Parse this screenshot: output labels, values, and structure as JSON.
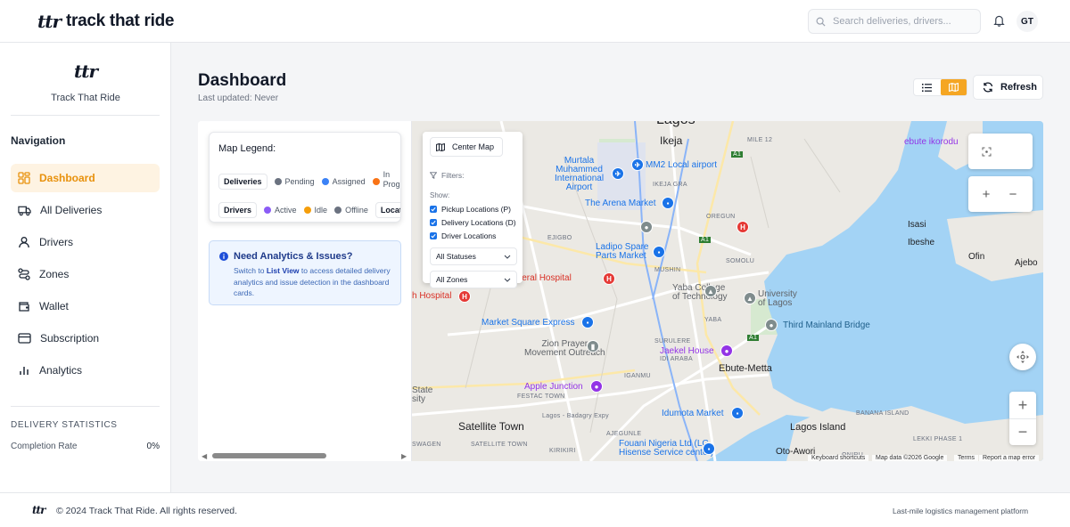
{
  "app": {
    "brand_mark": "ttr",
    "brand_name": "track that ride"
  },
  "header": {
    "search_placeholder": "Search deliveries, drivers...",
    "avatar_initials": "GT"
  },
  "sidebar": {
    "logo_mark": "ttr",
    "brand": "Track That Ride",
    "nav_title": "Navigation",
    "items": [
      {
        "label": "Dashboard",
        "icon": "grid-icon",
        "active": true
      },
      {
        "label": "All Deliveries",
        "icon": "truck-icon",
        "active": false
      },
      {
        "label": "Drivers",
        "icon": "user-icon",
        "active": false
      },
      {
        "label": "Zones",
        "icon": "route-icon",
        "active": false
      },
      {
        "label": "Wallet",
        "icon": "wallet-icon",
        "active": false
      },
      {
        "label": "Subscription",
        "icon": "credit-card-icon",
        "active": false
      },
      {
        "label": "Analytics",
        "icon": "bar-chart-icon",
        "active": false
      }
    ],
    "stats_title": "DELIVERY STATISTICS",
    "stats": [
      {
        "label": "Completion Rate",
        "value": "0%"
      }
    ]
  },
  "main": {
    "title": "Dashboard",
    "subtitle": "Last updated: Never",
    "view_modes": [
      "list",
      "map"
    ],
    "active_view": "map",
    "refresh_label": "Refresh"
  },
  "legend": {
    "title": "Map Legend:",
    "deliveries_label": "Deliveries",
    "deliveries": [
      {
        "label": "Pending",
        "color": "#6b7280"
      },
      {
        "label": "Assigned",
        "color": "#3b82f6"
      },
      {
        "label": "In Progress",
        "color": "#f97316"
      }
    ],
    "drivers_label": "Drivers",
    "drivers": [
      {
        "label": "Active",
        "color": "#8b5cf6"
      },
      {
        "label": "Idle",
        "color": "#f59e0b"
      },
      {
        "label": "Offline",
        "color": "#6b7280"
      }
    ],
    "locations_label": "Location"
  },
  "info": {
    "title": "Need Analytics & Issues?",
    "text_before": "Switch to ",
    "text_link": "List View",
    "text_after": " to access detailed delivery analytics and issue detection in the dashboard cards."
  },
  "map_controls": {
    "center_label": "Center Map",
    "filters_label": "Filters:",
    "show_label": "Show:",
    "checkboxes": [
      {
        "label": "Pickup Locations (P)",
        "checked": true
      },
      {
        "label": "Delivery Locations (D)",
        "checked": true
      },
      {
        "label": "Driver Locations",
        "checked": true
      }
    ],
    "status_select": "All Statuses",
    "zone_select": "All Zones"
  },
  "map": {
    "places": {
      "lagos": "Lagos",
      "ikeja": "Ikeja",
      "mile12": "MILE 12",
      "ebute_ikorodu": "ebute ikorodu",
      "mm2": "MM2 Local airport",
      "murtala": "Murtala\nMuhammed\nInternational\nAirport",
      "ikeja_gra": "IKEJA GRA",
      "arena": "The Arena Market",
      "oregun": "OREGUN",
      "ejigbo": "EJIGBO",
      "ladipo": "Ladipo Spare\nParts Market",
      "mushin": "MUSHIN",
      "somolu": "SOMOLU",
      "isasi": "Isasi",
      "ibeshe": "Ibeshe",
      "ofin": "Ofin",
      "ajebo": "Ajebo",
      "general_hospital": "o General Hospital",
      "hospital": "h Hospital",
      "yaba_college": "Yaba College\nof Technology",
      "unilag": "University\nof Lagos",
      "yaba": "YABA",
      "third_mainland": "Third Mainland Bridge",
      "market_square": "Market Square Express",
      "zion": "Zion Prayer\nMovement Outreach",
      "surulere": "SURULERE",
      "jaekel": "Jaekel House",
      "ebute_metta": "Ebute-Metta",
      "idi_araba": "IDI ARABA",
      "iganmu": "IGANMU",
      "apple": "Apple Junction",
      "festac": "FESTAC TOWN",
      "state": "State\nsity",
      "idumota": "Idumota Market",
      "banana": "BANANA ISLAND",
      "badagry": "Lagos - Badagry Expy",
      "satellite": "Satellite Town",
      "satellite_small": "SATELLITE TOWN",
      "swagen": "SWAGEN",
      "kirikiri": "KIRIKIRI",
      "ajegunle": "AJEGUNLE",
      "fouani": "Fouani Nigeria Ltd (LG\nHisense Service center)",
      "lagos_island": "Lagos Island",
      "lekki": "LEKKI PHASE 1",
      "oto_awori": "Oto-Awori",
      "oniru": "ONIRU",
      "a1": "A1"
    },
    "attribution": [
      "Keyboard shortcuts",
      "Map data ©2026 Google",
      "Terms",
      "Report a map error"
    ]
  },
  "footer": {
    "mark": "ttr",
    "copyright": "© 2024 Track That Ride. All rights reserved.",
    "tagline": "Last-mile logistics management platform"
  }
}
